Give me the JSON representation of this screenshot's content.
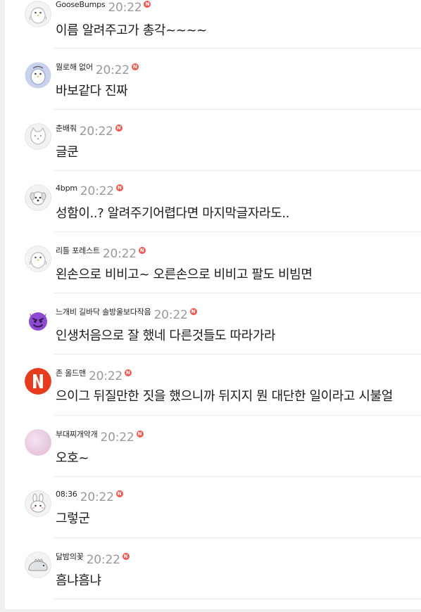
{
  "colors": {
    "new_badge": "#ee5a50",
    "time_text": "#9a9a9a",
    "body_text": "#1a1a1a"
  },
  "comments": [
    {
      "author": "GooseBumps",
      "time": "20:22",
      "badge": "N",
      "text": "이름 알려주고가 총각~~~~",
      "avatar_icon": "penguin-avatar-icon"
    },
    {
      "author": "뭘로해 없어",
      "time": "20:22",
      "badge": "N",
      "text": "바보같다 진짜",
      "avatar_icon": "penguin-blue-avatar-icon"
    },
    {
      "author": "춘배줘",
      "time": "20:22",
      "badge": "N",
      "text": "글쿤",
      "avatar_icon": "cat-avatar-icon"
    },
    {
      "author": "4bpm",
      "time": "20:22",
      "badge": "N",
      "text": "성함이..? 알려주기어렵다면 마지막글자라도..",
      "avatar_icon": "dog-avatar-icon"
    },
    {
      "author": "리틀 포레스트",
      "time": "20:22",
      "badge": "N",
      "text": "왼손으로 비비고~ 오른손으로 비비고 팔도 비빔면",
      "avatar_icon": "penguin-avatar-icon"
    },
    {
      "author": "느개비 길바닥 솔방울보다작음",
      "time": "20:22",
      "badge": "N",
      "text": "인생처음으로 잘 했네 다른것들도 따라가라",
      "avatar_icon": "devil-emoji-avatar-icon"
    },
    {
      "author": "존 올드맨",
      "time": "20:22",
      "badge": "N",
      "text": "으이그 뒤질만한 짓을 했으니까 뒤지지 뭔 대단한 일이라고 시불얼",
      "avatar_icon": "netflix-logo-avatar-icon"
    },
    {
      "author": "부대찌개악개",
      "time": "20:22",
      "badge": "N",
      "text": "오호~",
      "avatar_icon": "pink-circle-avatar-icon"
    },
    {
      "author": "08:36",
      "time": "20:22",
      "badge": "N",
      "text": "그렇군",
      "avatar_icon": "rabbit-avatar-icon"
    },
    {
      "author": "달밤의꽃",
      "time": "20:22",
      "badge": "N",
      "text": "흠냐흠냐",
      "avatar_icon": "dinosaur-avatar-icon"
    }
  ]
}
